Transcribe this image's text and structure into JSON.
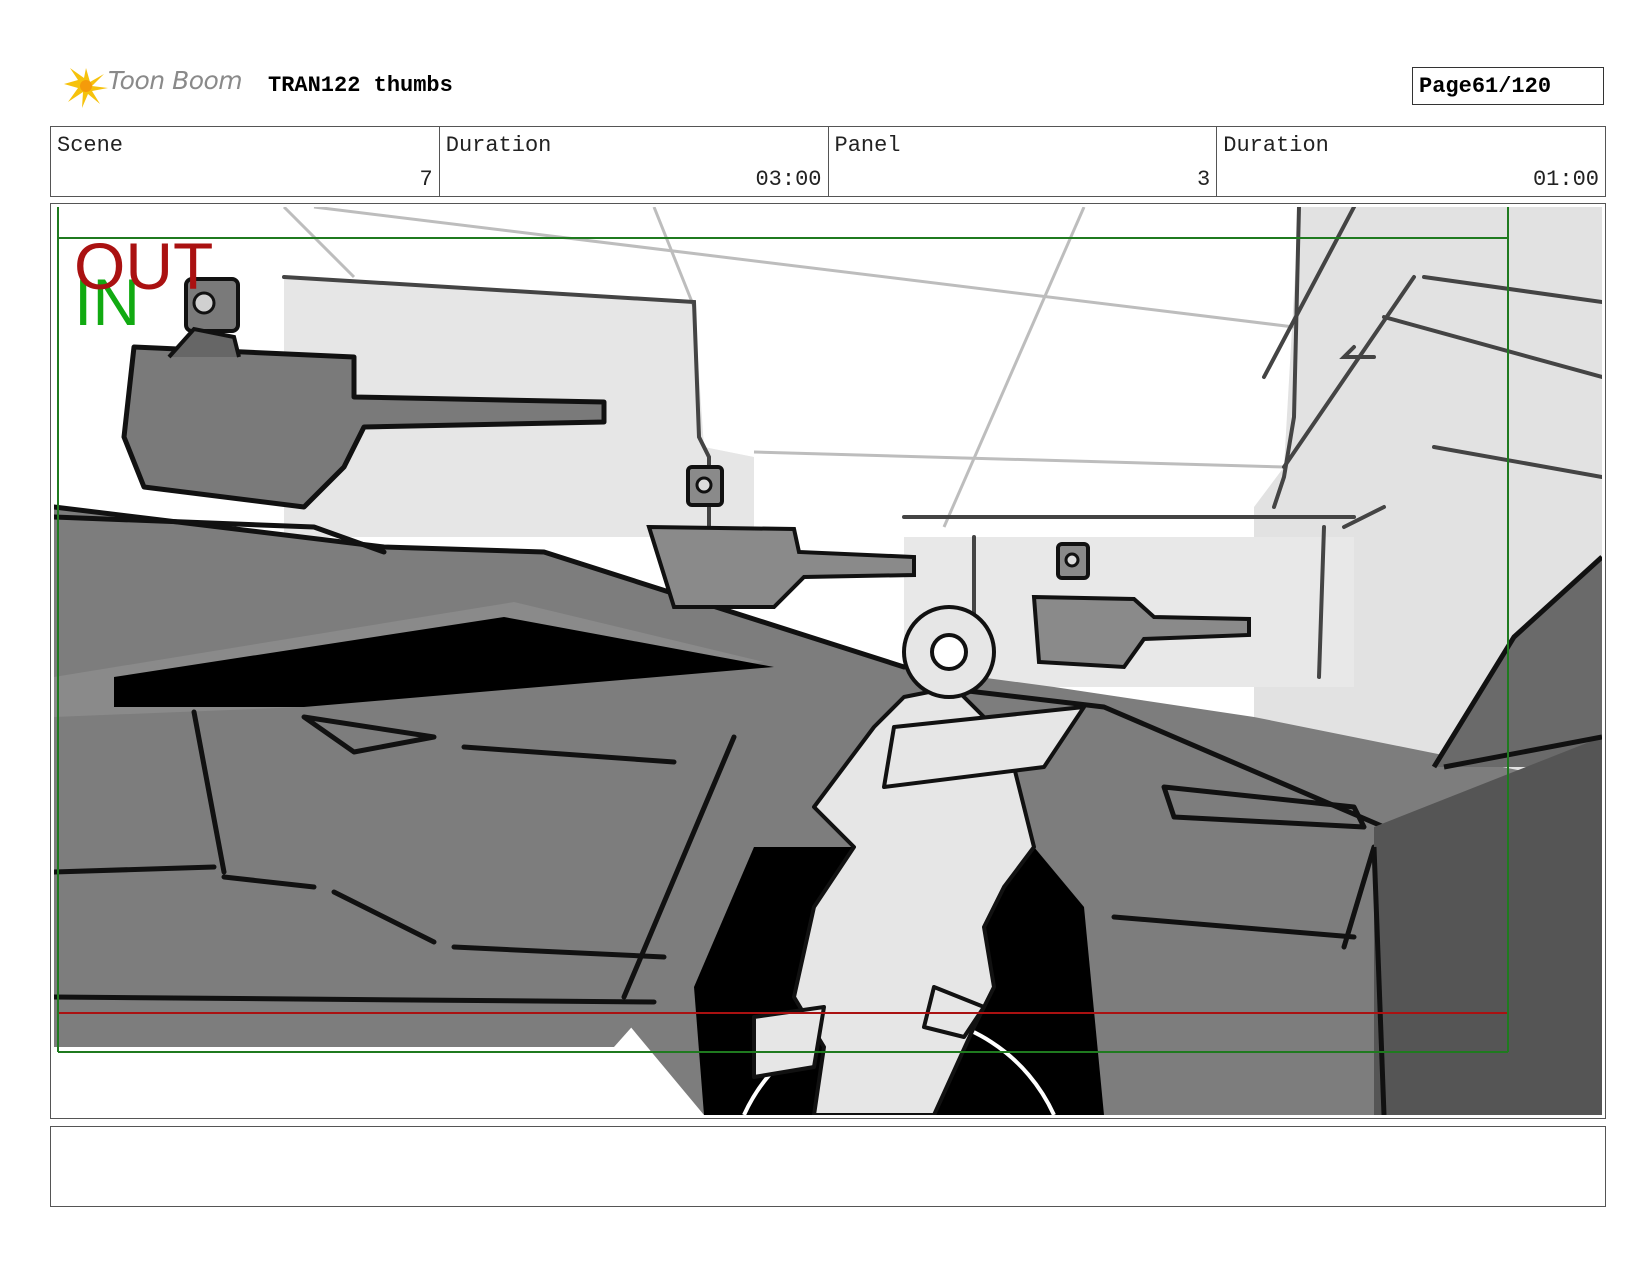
{
  "header": {
    "logo_text": "Toon Boom",
    "title": "TRAN122 thumbs",
    "page_label": "Page",
    "page_value": "61/120"
  },
  "info": {
    "scene_label": "Scene",
    "scene_value": "7",
    "scene_duration_label": "Duration",
    "scene_duration_value": "03:00",
    "panel_label": "Panel",
    "panel_value": "3",
    "panel_duration_label": "Duration",
    "panel_duration_value": "01:00"
  },
  "panel": {
    "out_label": "OUT",
    "in_label": "IN",
    "out_color": "#aa1111",
    "in_color": "#11aa11"
  },
  "notes": {
    "text": ""
  }
}
